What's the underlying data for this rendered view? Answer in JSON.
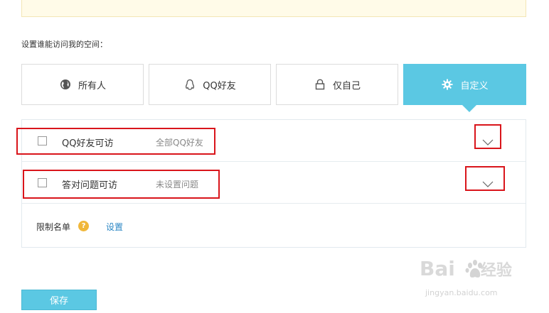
{
  "section_label": "设置谁能访问我的空间：",
  "options": [
    {
      "label": "所有人",
      "icon": "globe-icon",
      "active": false
    },
    {
      "label": "QQ好友",
      "icon": "qq-penguin-icon",
      "active": false
    },
    {
      "label": "仅自己",
      "icon": "lock-icon",
      "active": false
    },
    {
      "label": "自定义",
      "icon": "gear-icon",
      "active": true
    }
  ],
  "rules": [
    {
      "title": "QQ好友可访",
      "subtitle": "全部QQ好友"
    },
    {
      "title": "答对问题可访",
      "subtitle": "未设置问题"
    }
  ],
  "limit": {
    "label": "限制名单",
    "help_glyph": "?",
    "link": "设置"
  },
  "save_label": "保存",
  "watermark": {
    "main": "Bai",
    "brand_suffix": "经验",
    "sub": "jingyan.baidu.com"
  },
  "colors": {
    "accent": "#5bc8e3",
    "highlight": "#d9151b",
    "link": "#2a86c4",
    "help_badge": "#f0b73a"
  }
}
